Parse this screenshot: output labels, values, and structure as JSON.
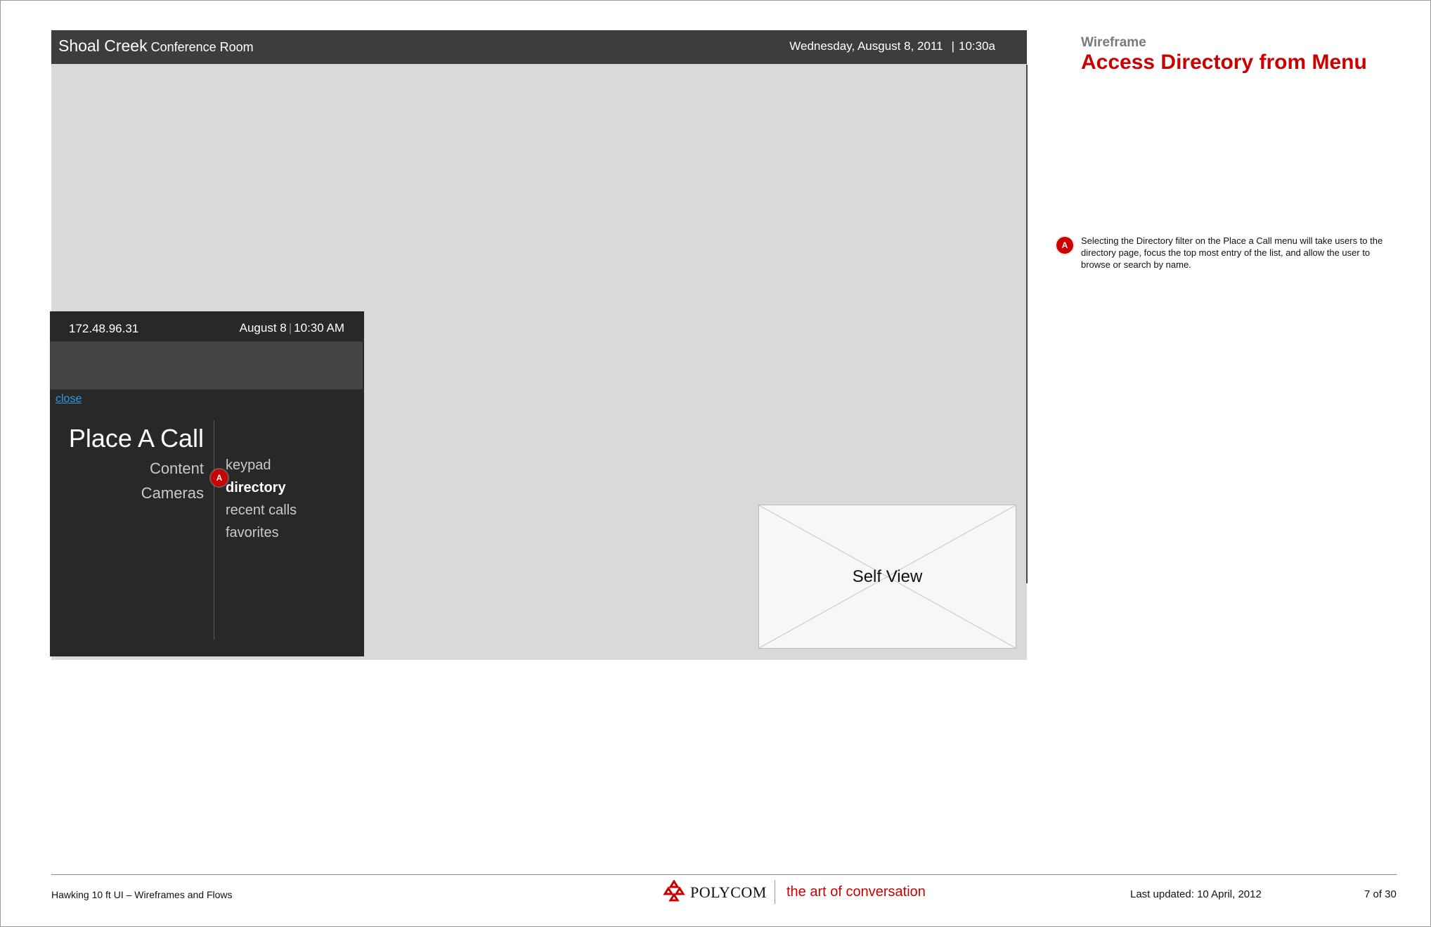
{
  "tv": {
    "room_name": "Shoal Creek",
    "room_suffix": "Conference Room",
    "date": "Wednesday, Ausgust 8, 2011",
    "time": "10:30a"
  },
  "menu": {
    "ip": "172.48.96.31",
    "date": "August 8",
    "time": "10:30 AM",
    "close_label": "close",
    "title": "Place A Call",
    "categories": [
      "Content",
      "Cameras"
    ],
    "options": [
      "keypad",
      "directory",
      "recent calls",
      "favorites"
    ],
    "selected_option": "directory",
    "marker": "A"
  },
  "self_view": {
    "label": "Self View"
  },
  "annotation": {
    "label": "Wireframe",
    "title": "Access Directory from Menu",
    "notes": [
      {
        "marker": "A",
        "text": "Selecting the Directory filter on the Place a Call menu will take users to the directory page, focus the top most entry of the list, and allow the user to browse or search by name."
      }
    ]
  },
  "footer": {
    "doc_title": "Hawking 10 ft UI – Wireframes and Flows",
    "brand": "POLYCOM",
    "tagline": "the art of conversation",
    "last_updated": "Last updated: 10 April, 2012",
    "page": "7 of 30"
  },
  "colors": {
    "accent": "#cc0000",
    "tv_bg": "#d9d9d9",
    "tv_header": "#3d3d3d",
    "menu_bg": "#282828",
    "link": "#2f9be3"
  }
}
